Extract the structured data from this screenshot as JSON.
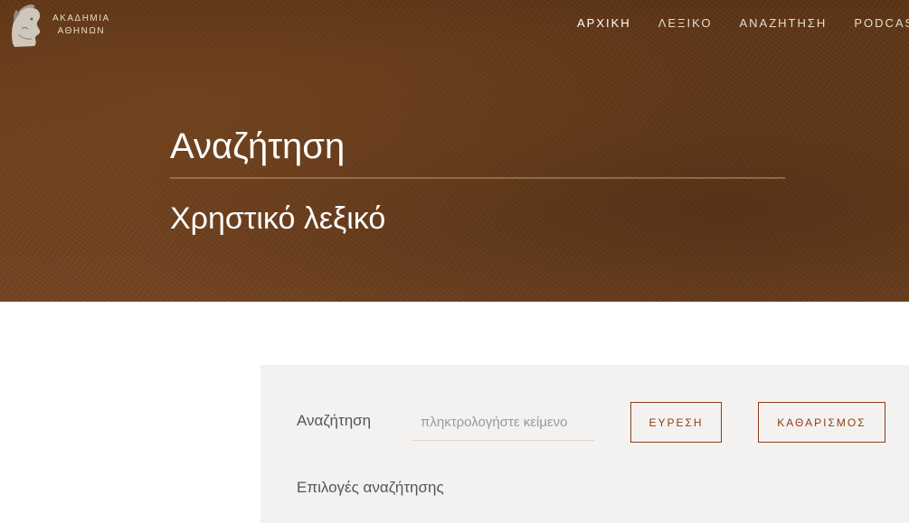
{
  "brand": {
    "line1": "ΑΚΑΔΗΜΙΑ",
    "line2": "ΑΘΗΝΩΝ",
    "emblem_icon": "athena-head-icon"
  },
  "nav": {
    "items": [
      {
        "label": "ΑΡΧΙΚΗ",
        "active": true
      },
      {
        "label": "ΛΕΞΙΚΟ",
        "active": false
      },
      {
        "label": "ΑΝΑΖΗΤΗΣΗ",
        "active": false
      },
      {
        "label": "PODCAST",
        "active": false
      }
    ]
  },
  "hero": {
    "title": "Αναζήτηση",
    "subtitle": "Χρηστικό λεξικό"
  },
  "search": {
    "label": "Αναζήτηση",
    "input_value": "",
    "placeholder": "πληκτρολογήστε κείμενο",
    "find_button": "ΕΥΡΕΣΗ",
    "clear_button": "ΚΑΘΑΡΙΣΜΟΣ",
    "options_label": "Επιλογές αναζήτησης"
  },
  "colors": {
    "hero_brown": "#5e3516",
    "accent": "#8c3d14",
    "panel_bg": "#f4f2f0"
  }
}
